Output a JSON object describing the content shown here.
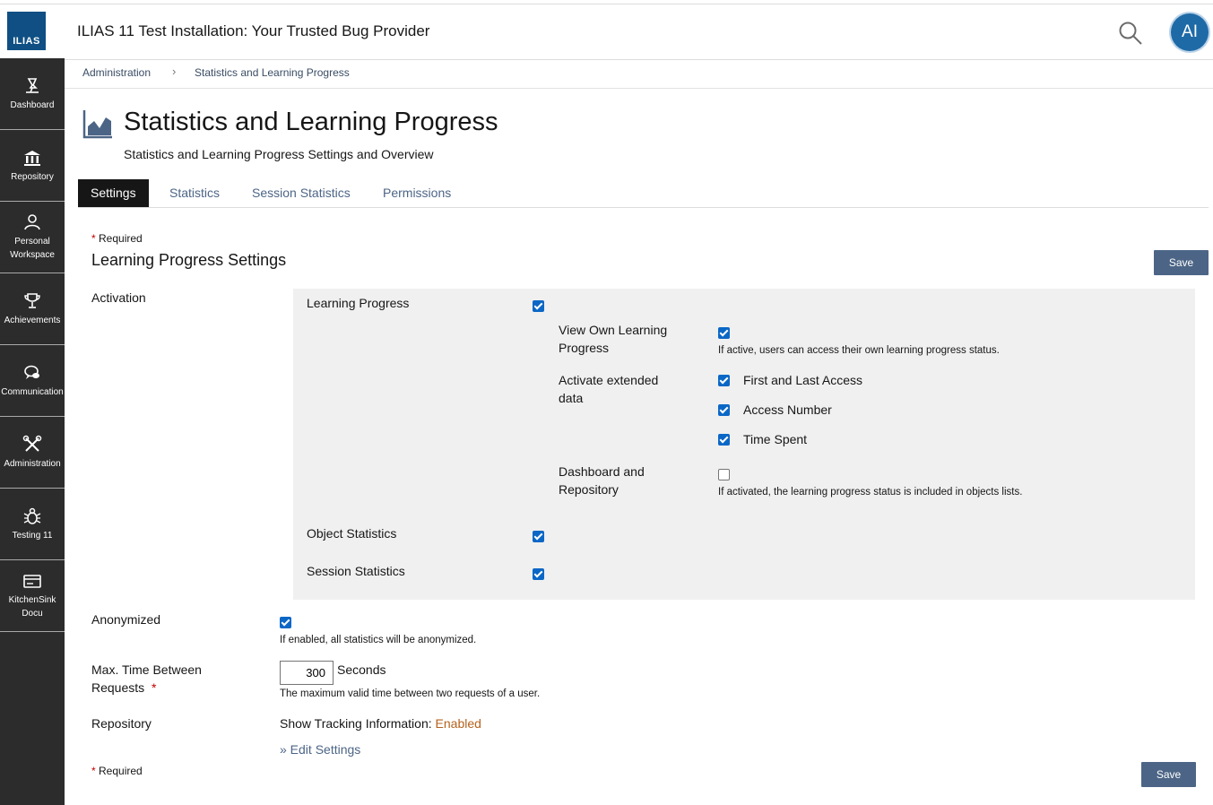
{
  "header": {
    "logo_text": "ILIAS",
    "title": "ILIAS 11 Test Installation: Your Trusted Bug Provider",
    "avatar_initials": "AI"
  },
  "sidebar": {
    "items": [
      {
        "label1": "Dashboard",
        "label2": "",
        "icon": "dashboard-icon"
      },
      {
        "label1": "Repository",
        "label2": "",
        "icon": "repository-icon"
      },
      {
        "label1": "Personal",
        "label2": "Workspace",
        "icon": "person-icon"
      },
      {
        "label1": "Achievements",
        "label2": "",
        "icon": "trophy-icon"
      },
      {
        "label1": "Communication",
        "label2": "",
        "icon": "chat-icon"
      },
      {
        "label1": "Administration",
        "label2": "",
        "icon": "tools-icon"
      },
      {
        "label1": "Testing 11",
        "label2": "",
        "icon": "bug-icon"
      },
      {
        "label1": "KitchenSink",
        "label2": "Docu",
        "icon": "card-icon"
      }
    ]
  },
  "breadcrumb": {
    "items": [
      "Administration",
      "Statistics and Learning Progress"
    ],
    "separator": "›"
  },
  "page": {
    "title": "Statistics and Learning Progress",
    "description": "Statistics and Learning Progress Settings and Overview"
  },
  "tabs": [
    "Settings",
    "Statistics",
    "Session Statistics",
    "Permissions"
  ],
  "form": {
    "required_star": "*",
    "required_label": "Required",
    "section_title": "Learning Progress Settings",
    "save_label": "Save",
    "activation": {
      "label": "Activation",
      "learning_progress": {
        "label": "Learning Progress",
        "checked": true
      },
      "view_own": {
        "label_line1": "View Own Learning",
        "label_line2": "Progress",
        "checked": true,
        "help": "If active, users can access their own learning progress status."
      },
      "extended": {
        "label_line1": "Activate extended",
        "label_line2": "data",
        "options": [
          {
            "label": "First and Last Access",
            "checked": true
          },
          {
            "label": "Access Number",
            "checked": true
          },
          {
            "label": "Time Spent",
            "checked": true
          }
        ]
      },
      "dashboard": {
        "label_line1": "Dashboard and",
        "label_line2": "Repository",
        "checked": false,
        "help": "If activated, the learning progress status is included in objects lists."
      },
      "object_statistics": {
        "label": "Object Statistics",
        "checked": true
      },
      "session_statistics": {
        "label": "Session Statistics",
        "checked": true
      }
    },
    "anonymized": {
      "label": "Anonymized",
      "checked": true,
      "help": "If enabled, all statistics will be anonymized."
    },
    "max_time": {
      "label_line1": "Max. Time Between",
      "label_line2": "Requests",
      "value": "300",
      "unit": "Seconds",
      "help": "The maximum valid time between two requests of a user."
    },
    "repository": {
      "label": "Repository",
      "tracking_label": "Show Tracking Information:",
      "tracking_value": "Enabled",
      "edit_link": "» Edit Settings"
    }
  },
  "colors": {
    "accent": "#4c6586",
    "checkbox": "#0b67c6",
    "sidebar": "#2c2c2c",
    "enabled": "#b5621e",
    "logo": "#0f4f83"
  }
}
